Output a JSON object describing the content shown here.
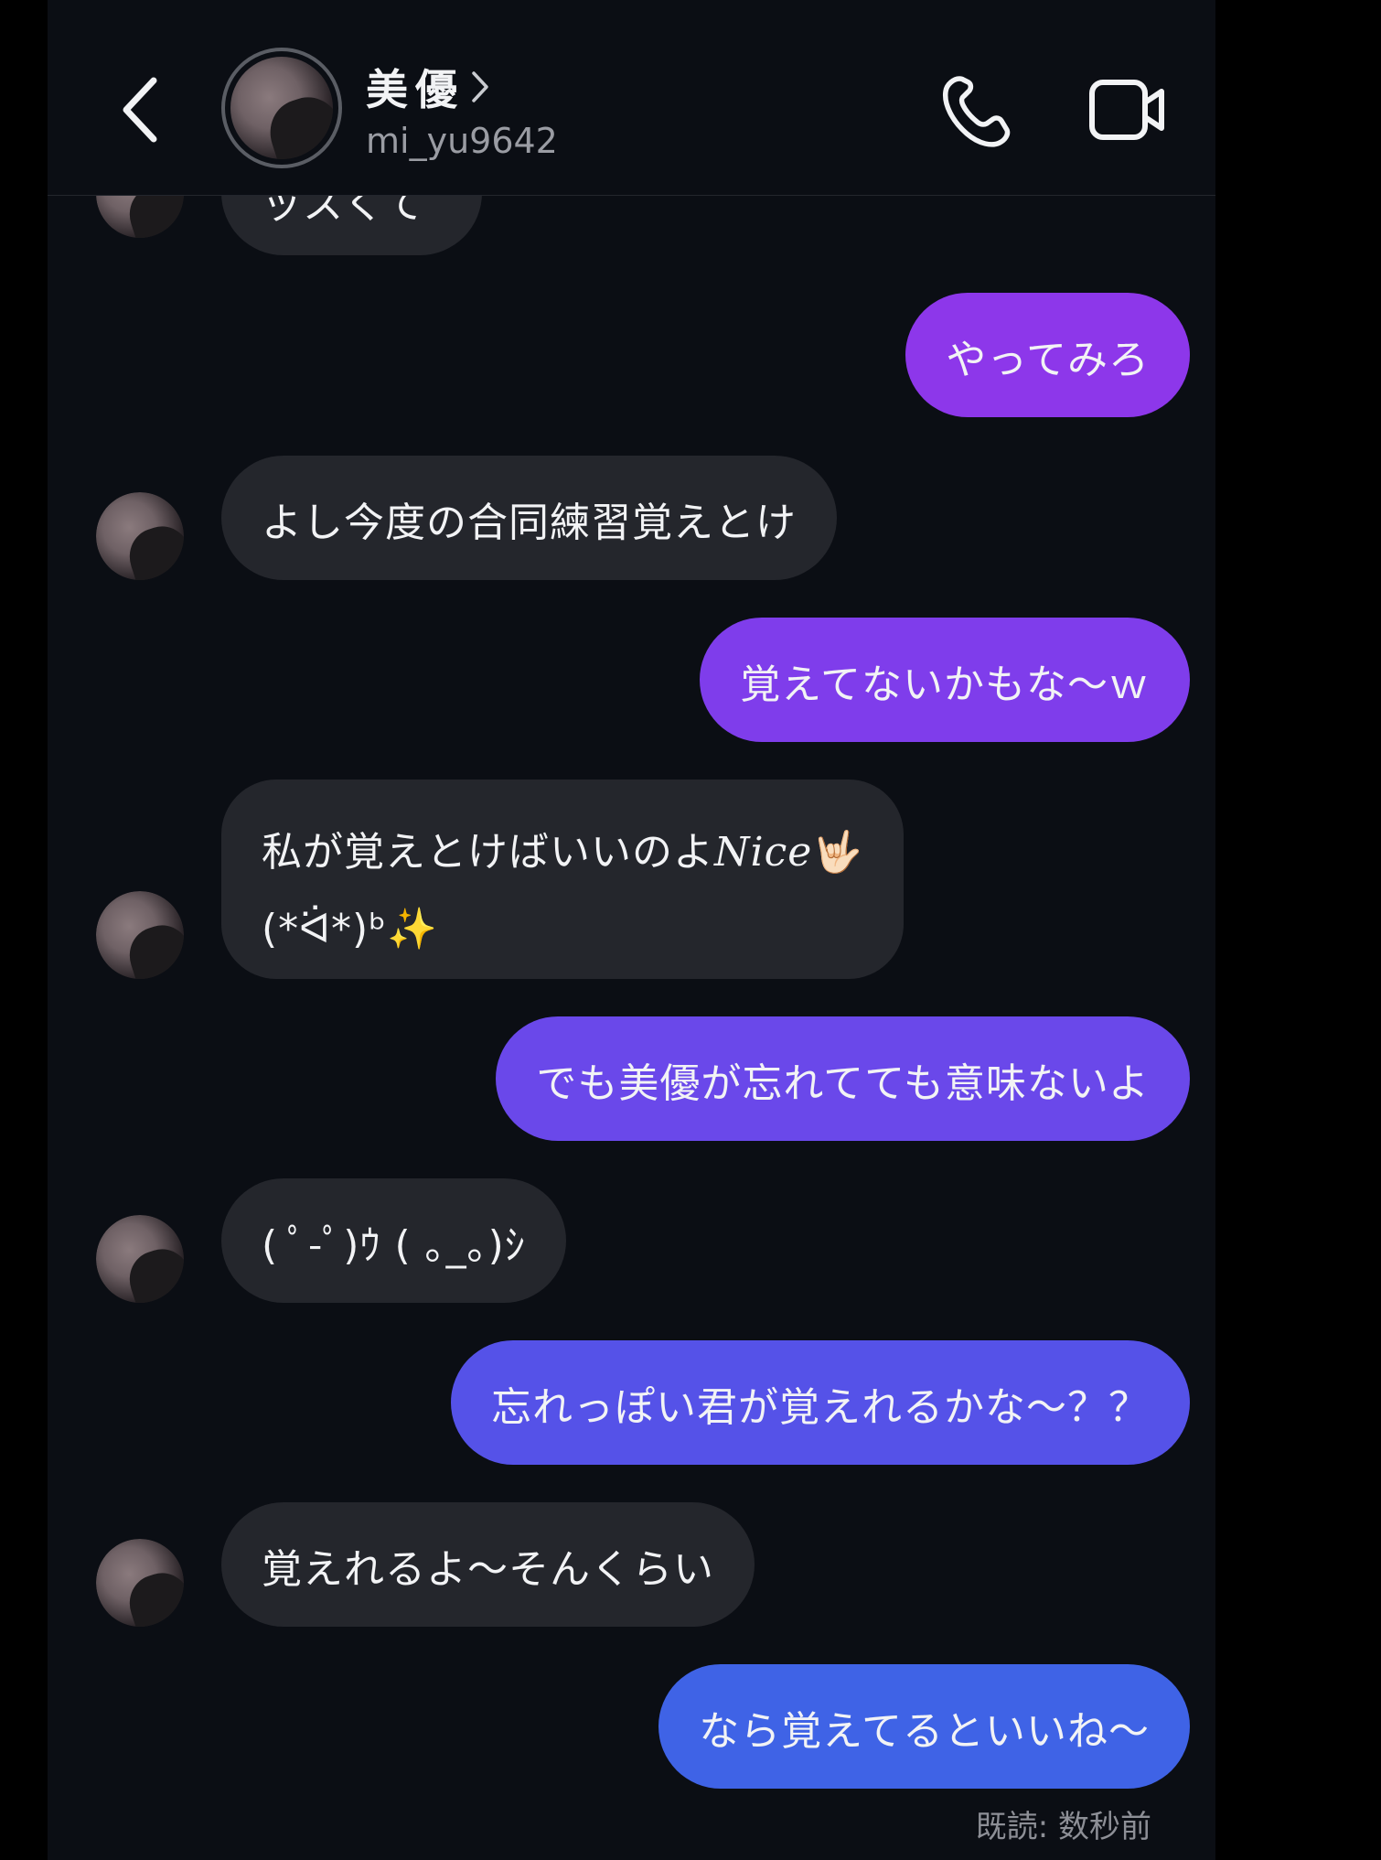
{
  "header": {
    "contact_name": "美優",
    "contact_handle": "mi_yu9642",
    "back_icon": "chevron-left-icon",
    "name_chevron_icon": "chevron-right-icon",
    "call_icon": "phone-icon",
    "video_icon": "video-camera-icon"
  },
  "messages": [
    {
      "from": "them",
      "text": "ッスくて"
    },
    {
      "from": "me",
      "text": "やってみろ"
    },
    {
      "from": "them",
      "text": "よし今度の合同練習覚えとけ"
    },
    {
      "from": "me",
      "text": "覚えてないかもな〜ｗ"
    },
    {
      "from": "them",
      "line1": "私が覚えとけばいいのよ",
      "line1_italic": "Nice",
      "line1_emoji": "🤟🏻",
      "line2": "(*ᐛ*)ᵇ✨"
    },
    {
      "from": "me",
      "text": "でも美優が忘れてても意味ないよ"
    },
    {
      "from": "them",
      "text": "( ﾟ-ﾟ)ｳ ( ｡_｡)ｼ"
    },
    {
      "from": "me",
      "text": "忘れっぽい君が覚えれるかな〜？？"
    },
    {
      "from": "them",
      "text": "覚えれるよ〜そんくらい"
    },
    {
      "from": "me",
      "text": "なら覚えてるといいね〜"
    }
  ],
  "read_receipt": "既読: 数秒前",
  "colors": {
    "background": "#0b0e14",
    "incoming_bubble": "#24262c",
    "outgoing_top": "#9135e8",
    "outgoing_bottom": "#3f63e6"
  }
}
